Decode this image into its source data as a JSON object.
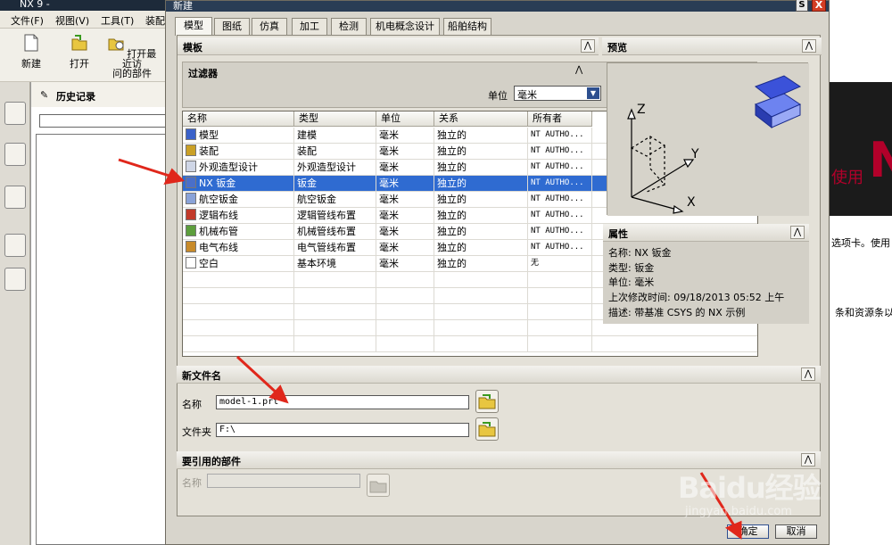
{
  "app": {
    "title": "NX 9 -",
    "menu": [
      "文件(F)",
      "视图(V)",
      "工具(T)",
      "装配"
    ],
    "toolbar": {
      "new_label": "新建",
      "open_label": "打开",
      "recent_label_1": "打开最近访",
      "recent_label_2": "问的部件"
    },
    "history_title": "历史记录",
    "bg_text_use": "使用",
    "bg_text_1": "选项卡。使用",
    "bg_text_2": "条和资源条以此",
    "bg_logo": "N"
  },
  "dialog": {
    "title": "新建",
    "help_glyph": "S",
    "close_glyph": "X",
    "tabs": [
      {
        "label": "模型",
        "active": true
      },
      {
        "label": "图纸",
        "active": false
      },
      {
        "label": "仿真",
        "active": false
      },
      {
        "label": "加工",
        "active": false
      },
      {
        "label": "检测",
        "active": false
      },
      {
        "label": "机电概念设计",
        "active": false
      },
      {
        "label": "船舶结构",
        "active": false
      }
    ],
    "templates_section": "模板",
    "filter": {
      "title": "过滤器",
      "unit_label": "单位",
      "unit_value": "毫米"
    },
    "table": {
      "columns": [
        "名称",
        "类型",
        "单位",
        "关系",
        "所有者"
      ],
      "rows": [
        {
          "name": "模型",
          "type": "建模",
          "unit": "毫米",
          "relation": "独立的",
          "owner": "NT AUTHO...",
          "selected": false
        },
        {
          "name": "装配",
          "type": "装配",
          "unit": "毫米",
          "relation": "独立的",
          "owner": "NT AUTHO...",
          "selected": false
        },
        {
          "name": "外观造型设计",
          "type": "外观造型设计",
          "unit": "毫米",
          "relation": "独立的",
          "owner": "NT AUTHO...",
          "selected": false
        },
        {
          "name": "NX 钣金",
          "type": "钣金",
          "unit": "毫米",
          "relation": "独立的",
          "owner": "NT AUTHO...",
          "selected": true
        },
        {
          "name": "航空钣金",
          "type": "航空钣金",
          "unit": "毫米",
          "relation": "独立的",
          "owner": "NT AUTHO...",
          "selected": false
        },
        {
          "name": "逻辑布线",
          "type": "逻辑管线布置",
          "unit": "毫米",
          "relation": "独立的",
          "owner": "NT AUTHO...",
          "selected": false
        },
        {
          "name": "机械布管",
          "type": "机械管线布置",
          "unit": "毫米",
          "relation": "独立的",
          "owner": "NT AUTHO...",
          "selected": false
        },
        {
          "name": "电气布线",
          "type": "电气管线布置",
          "unit": "毫米",
          "relation": "独立的",
          "owner": "NT AUTHO...",
          "selected": false
        },
        {
          "name": "空白",
          "type": "基本环境",
          "unit": "毫米",
          "relation": "独立的",
          "owner": "无",
          "selected": false
        }
      ]
    },
    "preview": {
      "title": "预览",
      "axis_z": "Z",
      "axis_y": "Y",
      "axis_x": "X"
    },
    "properties": {
      "title": "属性",
      "lines": [
        "名称:  NX 钣金",
        "类型:  钣金",
        "单位:  毫米",
        "上次修改时间:  09/18/2013 05:52 上午",
        "描述:  带基准 CSYS 的 NX 示例"
      ]
    },
    "new_file": {
      "title": "新文件名",
      "name_label": "名称",
      "name_value": "model-1.prt",
      "folder_label": "文件夹",
      "folder_value": "F:\\"
    },
    "ref_parts": {
      "title": "要引用的部件",
      "name_label": "名称"
    },
    "ok_label": "确定",
    "cancel_label": "取消"
  },
  "watermark": {
    "logo": "Baidu经验",
    "url": "jingyan.baidu.com"
  },
  "colors": {
    "selection": "#2f6bd1",
    "annotation_arrow": "#e0271b",
    "dialog_bg": "#d8d5cc"
  }
}
